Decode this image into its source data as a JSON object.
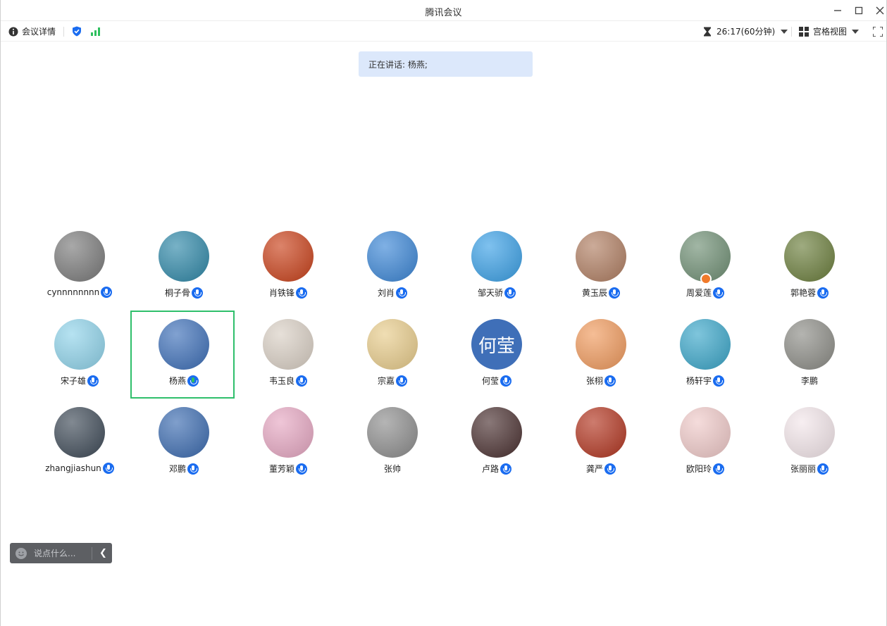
{
  "window": {
    "title": "腾讯会议"
  },
  "toolbar": {
    "meeting_info": "会议详情",
    "timer": "26:17(60分钟)",
    "view_mode": "宫格视图"
  },
  "speaking_banner": "正在讲话: 杨燕;",
  "participants": [
    {
      "name": "cynnnnnnnn",
      "mic": "on",
      "avatar_color": "#7a7a7a"
    },
    {
      "name": "桐子骨",
      "mic": "on",
      "avatar_color": "#2f88a8"
    },
    {
      "name": "肖铁锋",
      "mic": "on",
      "avatar_color": "#c9411a"
    },
    {
      "name": "刘肖",
      "mic": "on",
      "avatar_color": "#3b86d6"
    },
    {
      "name": "邹天骄",
      "mic": "on",
      "avatar_color": "#3aa0e6"
    },
    {
      "name": "黄玉辰",
      "mic": "on",
      "avatar_color": "#b07e62"
    },
    {
      "name": "周爱莲",
      "mic": "on",
      "avatar_color": "#6f8f74",
      "host": true
    },
    {
      "name": "郭艳蓉",
      "mic": "on",
      "avatar_color": "#6b7e3c"
    },
    {
      "name": "宋子雄",
      "mic": "on",
      "avatar_color": "#8fd3ea"
    },
    {
      "name": "杨燕",
      "mic": "speaking",
      "avatar_color": "#3d6fb8",
      "selected": true
    },
    {
      "name": "韦玉良",
      "mic": "on",
      "avatar_color": "#d9cfc4"
    },
    {
      "name": "宗嘉",
      "mic": "on",
      "avatar_color": "#e8cc8b"
    },
    {
      "name": "何莹",
      "mic": "on",
      "avatar_color": "#3f6fb8",
      "avatar_text": "何莹"
    },
    {
      "name": "张栩",
      "mic": "on",
      "avatar_color": "#f09a5d"
    },
    {
      "name": "杨轩宇",
      "mic": "on",
      "avatar_color": "#3aa6c9"
    },
    {
      "name": "李鹏",
      "mic": "off",
      "avatar_color": "#8c8c86"
    },
    {
      "name": "zhangjiashun",
      "mic": "on",
      "avatar_color": "#3e4a57"
    },
    {
      "name": "邓鹏",
      "mic": "on",
      "avatar_color": "#3b6bb0"
    },
    {
      "name": "董芳颖",
      "mic": "on",
      "avatar_color": "#e6a7c2"
    },
    {
      "name": "张帅",
      "mic": "off",
      "avatar_color": "#8d8d8d"
    },
    {
      "name": "卢路",
      "mic": "on",
      "avatar_color": "#4a3030"
    },
    {
      "name": "龚严",
      "mic": "on",
      "avatar_color": "#b23520"
    },
    {
      "name": "欧阳玲",
      "mic": "on",
      "avatar_color": "#efc9c8"
    },
    {
      "name": "张丽丽",
      "mic": "on",
      "avatar_color": "#f3e6ea"
    }
  ],
  "chat": {
    "placeholder": "说点什么..."
  },
  "colors": {
    "accent": "#1a6cf0",
    "speaking": "#2fc05f",
    "selected_border": "#2fbf6b",
    "banner": "#dce8fb"
  }
}
